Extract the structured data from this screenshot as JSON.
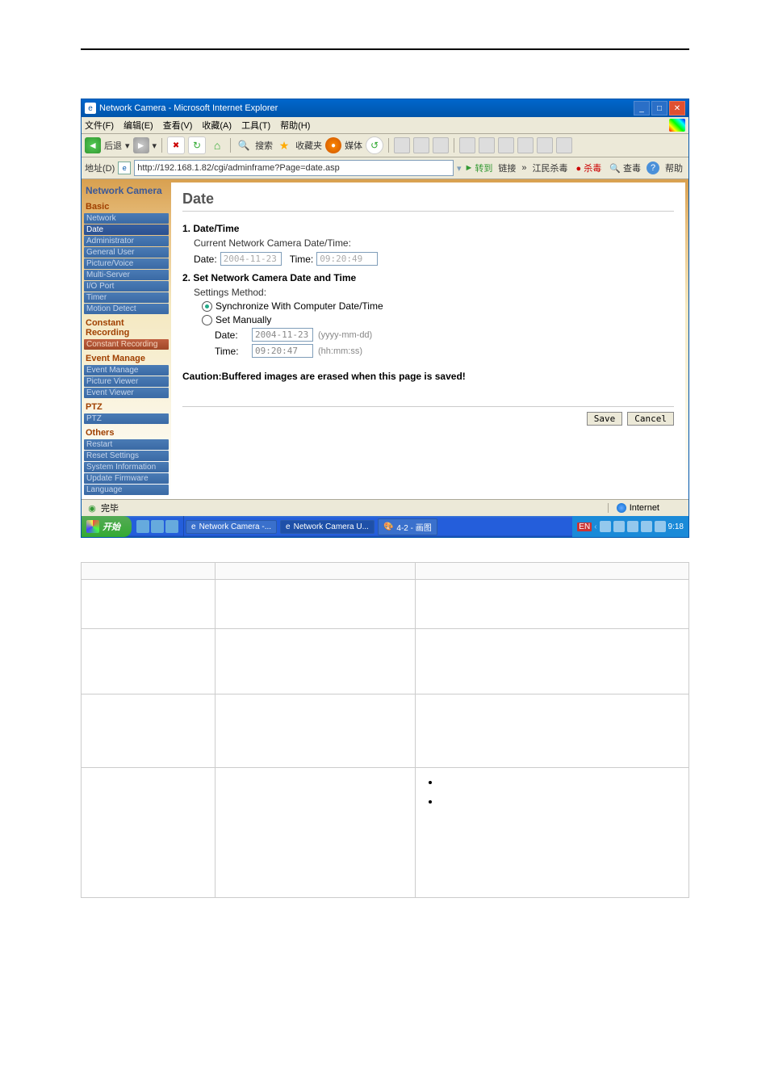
{
  "title": "Network Camera - Microsoft Internet Explorer",
  "menubar": {
    "file": "文件(F)",
    "edit": "编辑(E)",
    "view": "查看(V)",
    "fav": "收藏(A)",
    "tools": "工具(T)",
    "help": "帮助(H)"
  },
  "toolbar": {
    "back": "后退",
    "search": "搜索",
    "fav": "收藏夹",
    "media": "媒体"
  },
  "address": {
    "label": "地址(D)",
    "url": "http://192.168.1.82/cgi/adminframe?Page=date.asp",
    "go": "转到",
    "links": "链接",
    "link1": "江民杀毒",
    "link2": "杀毒",
    "link3": "查毒",
    "help": "帮助"
  },
  "sidebar": {
    "title": "Network Camera",
    "groups": [
      {
        "title": "Basic",
        "items": [
          "Network",
          "Date",
          "Administrator",
          "General User",
          "Picture/Voice",
          "Multi-Server",
          "I/O Port",
          "Timer",
          "Motion Detect"
        ],
        "selected": 1
      },
      {
        "title": "Constant Recording",
        "items": [
          "Constant Recording"
        ],
        "alt": true
      },
      {
        "title": "Event Manage",
        "items": [
          "Event Manage",
          "Picture Viewer",
          "Event Viewer"
        ]
      },
      {
        "title": "PTZ",
        "items": [
          "PTZ"
        ]
      },
      {
        "title": "Others",
        "items": [
          "Restart",
          "Reset Settings",
          "System Information",
          "Update Firmware",
          "Language"
        ]
      }
    ]
  },
  "main": {
    "heading": "Date",
    "sec1_title": "1. Date/Time",
    "sec1_sub": "Current Network Camera Date/Time:",
    "date_lbl": "Date:",
    "date_val": "2004-11-23",
    "time_lbl": "Time:",
    "time_val": "09:20:49",
    "sec2_title": "2. Set Network Camera Date and Time",
    "sec2_sub": "Settings Method:",
    "radio1": "Synchronize With Computer Date/Time",
    "radio2": "Set Manually",
    "man_date_lbl": "Date:",
    "man_date_val": "2004-11-23",
    "man_date_hint": "(yyyy-mm-dd)",
    "man_time_lbl": "Time:",
    "man_time_val": "09:20:47",
    "man_time_hint": "(hh:mm:ss)",
    "caution": "Caution:Buffered images are erased when this page is saved!",
    "save": "Save",
    "cancel": "Cancel"
  },
  "statusbar": {
    "done": "完毕",
    "zone": "Internet"
  },
  "taskbar": {
    "start": "开始",
    "task1": "Network Camera -...",
    "task2": "Network Camera U...",
    "task3": "4-2 - 画图",
    "clock": "9:18"
  }
}
